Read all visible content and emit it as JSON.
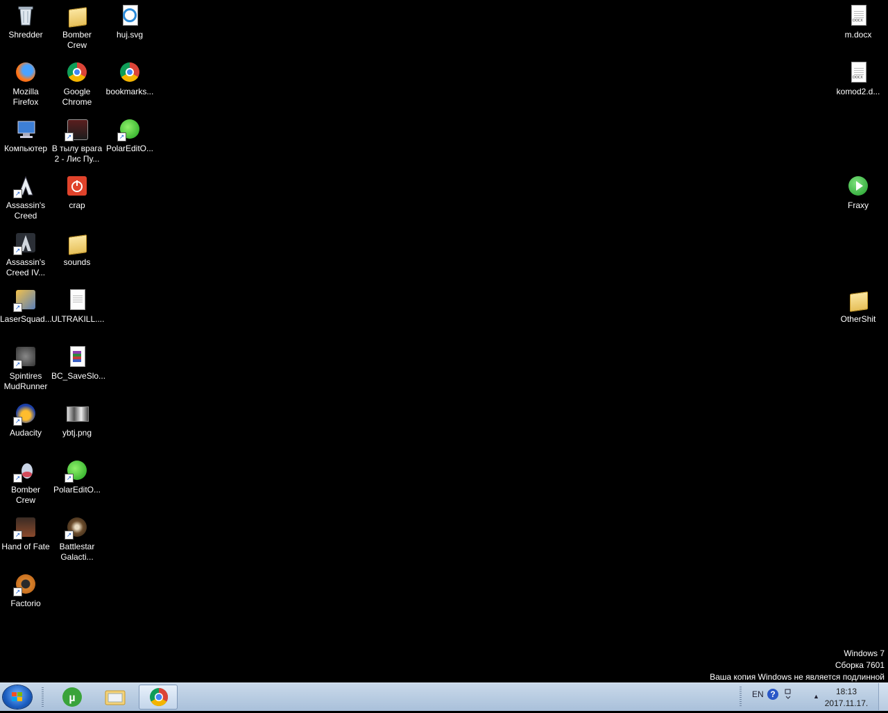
{
  "desktop": {
    "icons": {
      "shredder": "Shredder",
      "bomber_crew_folder": "Bomber\nCrew",
      "huj_svg": "huj.svg",
      "firefox": "Mozilla\nFirefox",
      "chrome": "Google\nChrome",
      "bookmarks": "bookmarks...",
      "computer": "Компьютер",
      "v_tylu": "В тылу врага\n2 - Лис Пу...",
      "polaredit1": "PolarEditO...",
      "assassins_creed": "Assassin's\nCreed",
      "crap": "crap",
      "assassins_creed_iv": "Assassin's\nCreed IV...",
      "sounds": "sounds",
      "lasersquad": "LaserSquad...",
      "ultrakill": "ULTRAKILL....",
      "spintires": "Spintires\nMudRunner",
      "bc_saveslo": "BC_SaveSlo...",
      "audacity": "Audacity",
      "ybtj": "ybtj.png",
      "bomber_crew_game": "Bomber\nCrew",
      "polaredit2": "PolarEditO...",
      "hand_of_fate": "Hand of Fate",
      "battlestar": "Battlestar\nGalacti...",
      "factorio": "Factorio",
      "m_docx": "m.docx",
      "komod2": "komod2.d...",
      "fraxy": "Fraxy",
      "othershit": "OtherShit"
    },
    "docx_tag": "DOCX"
  },
  "watermark": {
    "line1": "Windows 7",
    "line2": "Сборка 7601",
    "line3": "Ваша копия Windows не является подлинной"
  },
  "taskbar": {
    "apps": [
      "utorrent-icon",
      "explorer-icon",
      "chrome-icon"
    ],
    "tray": {
      "lang": "EN",
      "help": "?",
      "time": "18:13",
      "date": "2017.11.17."
    }
  },
  "colors": {
    "desktop_bg": "#000000",
    "taskbar": "#b5c9df"
  }
}
